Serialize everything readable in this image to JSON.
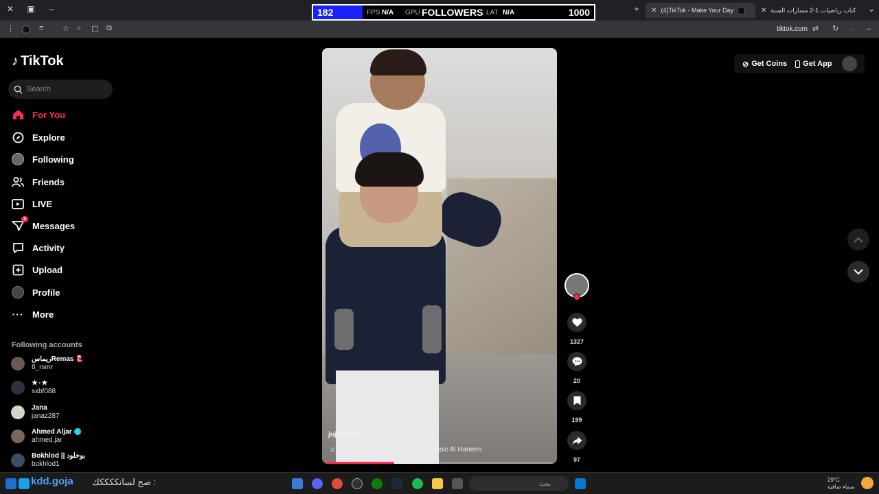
{
  "browser": {
    "tabs": [
      {
        "title": "(4)TikTok - Make Your Day",
        "active": true
      },
      {
        "title": "كتاب رياضيات 1-2 مسارات السنة",
        "active": false
      }
    ],
    "new_tab": "+",
    "url": "tiktok.com"
  },
  "stream_overlay": {
    "count": "182",
    "fps_label": "FPS",
    "fps_value": "N/A",
    "gpu_label": "GPU",
    "title": "FOLLOWERS",
    "lat_label": "LAT",
    "lat_value": "N/A",
    "goal": "1000"
  },
  "sidebar": {
    "logo": "TikTok",
    "search_placeholder": "Search",
    "nav": [
      {
        "label": "For You",
        "icon": "home-icon",
        "active": true
      },
      {
        "label": "Explore",
        "icon": "compass-icon"
      },
      {
        "label": "Following",
        "icon": "following-avatar-icon"
      },
      {
        "label": "Friends",
        "icon": "friends-icon"
      },
      {
        "label": "LIVE",
        "icon": "live-icon"
      },
      {
        "label": "Messages",
        "icon": "messages-icon",
        "badge": "4"
      },
      {
        "label": "Activity",
        "icon": "activity-icon"
      },
      {
        "label": "Upload",
        "icon": "upload-icon"
      },
      {
        "label": "Profile",
        "icon": "profile-avatar-icon"
      },
      {
        "label": "More",
        "icon": "more-icon"
      }
    ],
    "following_title": "Following accounts",
    "accounts": [
      {
        "name": "ريماسRemas 🪼",
        "handle": "8_rsmr",
        "verified": false
      },
      {
        "name": "★٠★",
        "handle": "sxbf088",
        "verified": false
      },
      {
        "name": "Jana",
        "handle": "janaz287",
        "verified": false
      },
      {
        "name": "Ahmed Aljar",
        "handle": "ahmed.jar",
        "verified": true
      },
      {
        "name": "Bokhlod || بوخلود",
        "handle": "bokhlod1",
        "verified": false
      }
    ]
  },
  "video": {
    "username": "jujualsh5",
    "music": "الصوت الأصلي - ميوزك الحنين | Music Al Haneen",
    "progress": 0.3,
    "more": "···"
  },
  "actions": {
    "likes": "1327",
    "comments": "20",
    "saves": "199",
    "shares": "97"
  },
  "topbar": {
    "get_coins": "Get Coins",
    "get_app": "Get App"
  },
  "taskbar": {
    "left_text": "kdd.goja",
    "left_text2": "صح لسانككككك :",
    "search_placeholder": "بحث",
    "weather_temp": "29°C",
    "weather_desc": "سماء صافية"
  },
  "colors": {
    "accent": "#fe2c55",
    "overlay_blue": "#1a23ff"
  }
}
